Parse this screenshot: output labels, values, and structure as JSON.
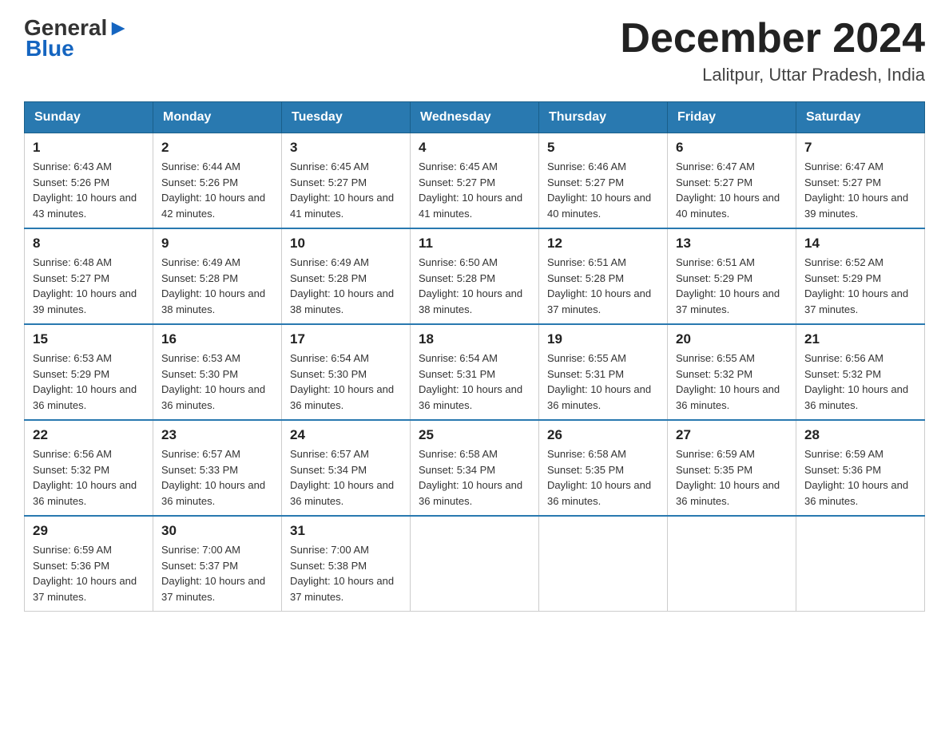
{
  "header": {
    "logo_general": "General",
    "logo_blue": "Blue",
    "month_title": "December 2024",
    "location": "Lalitpur, Uttar Pradesh, India"
  },
  "days_of_week": [
    "Sunday",
    "Monday",
    "Tuesday",
    "Wednesday",
    "Thursday",
    "Friday",
    "Saturday"
  ],
  "weeks": [
    [
      {
        "day": "1",
        "sunrise": "6:43 AM",
        "sunset": "5:26 PM",
        "daylight": "10 hours and 43 minutes."
      },
      {
        "day": "2",
        "sunrise": "6:44 AM",
        "sunset": "5:26 PM",
        "daylight": "10 hours and 42 minutes."
      },
      {
        "day": "3",
        "sunrise": "6:45 AM",
        "sunset": "5:27 PM",
        "daylight": "10 hours and 41 minutes."
      },
      {
        "day": "4",
        "sunrise": "6:45 AM",
        "sunset": "5:27 PM",
        "daylight": "10 hours and 41 minutes."
      },
      {
        "day": "5",
        "sunrise": "6:46 AM",
        "sunset": "5:27 PM",
        "daylight": "10 hours and 40 minutes."
      },
      {
        "day": "6",
        "sunrise": "6:47 AM",
        "sunset": "5:27 PM",
        "daylight": "10 hours and 40 minutes."
      },
      {
        "day": "7",
        "sunrise": "6:47 AM",
        "sunset": "5:27 PM",
        "daylight": "10 hours and 39 minutes."
      }
    ],
    [
      {
        "day": "8",
        "sunrise": "6:48 AM",
        "sunset": "5:27 PM",
        "daylight": "10 hours and 39 minutes."
      },
      {
        "day": "9",
        "sunrise": "6:49 AM",
        "sunset": "5:28 PM",
        "daylight": "10 hours and 38 minutes."
      },
      {
        "day": "10",
        "sunrise": "6:49 AM",
        "sunset": "5:28 PM",
        "daylight": "10 hours and 38 minutes."
      },
      {
        "day": "11",
        "sunrise": "6:50 AM",
        "sunset": "5:28 PM",
        "daylight": "10 hours and 38 minutes."
      },
      {
        "day": "12",
        "sunrise": "6:51 AM",
        "sunset": "5:28 PM",
        "daylight": "10 hours and 37 minutes."
      },
      {
        "day": "13",
        "sunrise": "6:51 AM",
        "sunset": "5:29 PM",
        "daylight": "10 hours and 37 minutes."
      },
      {
        "day": "14",
        "sunrise": "6:52 AM",
        "sunset": "5:29 PM",
        "daylight": "10 hours and 37 minutes."
      }
    ],
    [
      {
        "day": "15",
        "sunrise": "6:53 AM",
        "sunset": "5:29 PM",
        "daylight": "10 hours and 36 minutes."
      },
      {
        "day": "16",
        "sunrise": "6:53 AM",
        "sunset": "5:30 PM",
        "daylight": "10 hours and 36 minutes."
      },
      {
        "day": "17",
        "sunrise": "6:54 AM",
        "sunset": "5:30 PM",
        "daylight": "10 hours and 36 minutes."
      },
      {
        "day": "18",
        "sunrise": "6:54 AM",
        "sunset": "5:31 PM",
        "daylight": "10 hours and 36 minutes."
      },
      {
        "day": "19",
        "sunrise": "6:55 AM",
        "sunset": "5:31 PM",
        "daylight": "10 hours and 36 minutes."
      },
      {
        "day": "20",
        "sunrise": "6:55 AM",
        "sunset": "5:32 PM",
        "daylight": "10 hours and 36 minutes."
      },
      {
        "day": "21",
        "sunrise": "6:56 AM",
        "sunset": "5:32 PM",
        "daylight": "10 hours and 36 minutes."
      }
    ],
    [
      {
        "day": "22",
        "sunrise": "6:56 AM",
        "sunset": "5:32 PM",
        "daylight": "10 hours and 36 minutes."
      },
      {
        "day": "23",
        "sunrise": "6:57 AM",
        "sunset": "5:33 PM",
        "daylight": "10 hours and 36 minutes."
      },
      {
        "day": "24",
        "sunrise": "6:57 AM",
        "sunset": "5:34 PM",
        "daylight": "10 hours and 36 minutes."
      },
      {
        "day": "25",
        "sunrise": "6:58 AM",
        "sunset": "5:34 PM",
        "daylight": "10 hours and 36 minutes."
      },
      {
        "day": "26",
        "sunrise": "6:58 AM",
        "sunset": "5:35 PM",
        "daylight": "10 hours and 36 minutes."
      },
      {
        "day": "27",
        "sunrise": "6:59 AM",
        "sunset": "5:35 PM",
        "daylight": "10 hours and 36 minutes."
      },
      {
        "day": "28",
        "sunrise": "6:59 AM",
        "sunset": "5:36 PM",
        "daylight": "10 hours and 36 minutes."
      }
    ],
    [
      {
        "day": "29",
        "sunrise": "6:59 AM",
        "sunset": "5:36 PM",
        "daylight": "10 hours and 37 minutes."
      },
      {
        "day": "30",
        "sunrise": "7:00 AM",
        "sunset": "5:37 PM",
        "daylight": "10 hours and 37 minutes."
      },
      {
        "day": "31",
        "sunrise": "7:00 AM",
        "sunset": "5:38 PM",
        "daylight": "10 hours and 37 minutes."
      },
      null,
      null,
      null,
      null
    ]
  ]
}
